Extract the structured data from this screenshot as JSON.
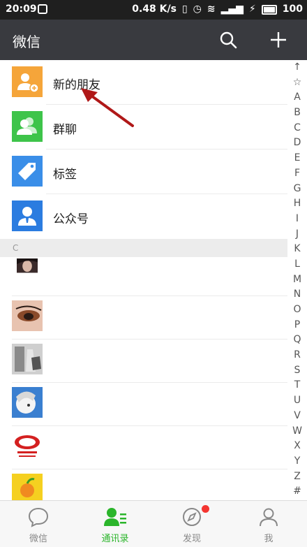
{
  "status": {
    "time": "20:09",
    "speed": "0.48 K/s",
    "battery": "100"
  },
  "header": {
    "title": "微信"
  },
  "menu": [
    {
      "label": "新的朋友",
      "color": "#f5a53a"
    },
    {
      "label": "群聊",
      "color": "#3ec44a"
    },
    {
      "label": "标签",
      "color": "#3a8ee8"
    },
    {
      "label": "公众号",
      "color": "#2b7ce0"
    }
  ],
  "section_letter": "C",
  "index_letters": [
    "↑",
    "☆",
    "A",
    "B",
    "C",
    "D",
    "E",
    "F",
    "G",
    "H",
    "I",
    "J",
    "K",
    "L",
    "M",
    "N",
    "O",
    "P",
    "Q",
    "R",
    "S",
    "T",
    "U",
    "V",
    "W",
    "X",
    "Y",
    "Z",
    "#"
  ],
  "tabs": [
    {
      "label": "微信"
    },
    {
      "label": "通讯录"
    },
    {
      "label": "发现"
    },
    {
      "label": "我"
    }
  ]
}
